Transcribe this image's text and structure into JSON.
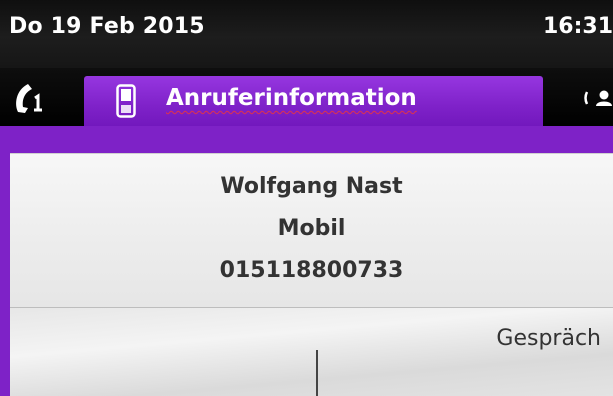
{
  "status_bar": {
    "date": "Do 19 Feb 2015",
    "time": "16:31"
  },
  "tabs": {
    "left_icon": "handset-call-icon",
    "active": {
      "icon": "mobile-phone-icon",
      "label": "Anruferinformation"
    },
    "right_icon": "contacts-icon"
  },
  "caller_info": {
    "name": "Wolfgang Nast",
    "number_type": "Mobil",
    "number": "015118800733"
  },
  "softkeys": {
    "right_label": "Gespräch"
  },
  "colors": {
    "accent_purple": "#7e22c7",
    "status_bar_bg": "#161616",
    "panel_bg": "#ededed",
    "text_dark": "#333333"
  }
}
